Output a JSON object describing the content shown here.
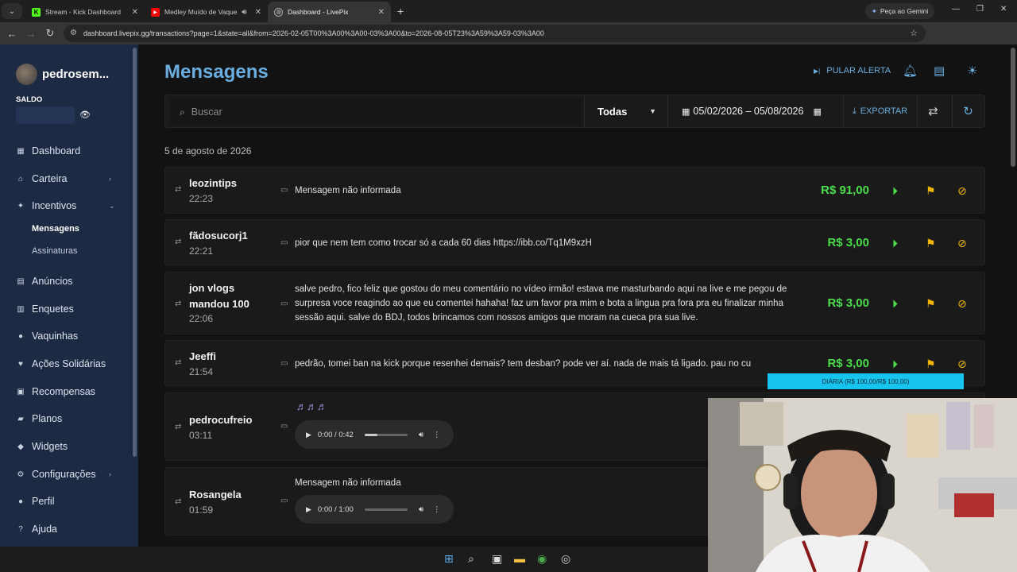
{
  "browser": {
    "tabs": [
      {
        "title": "Stream - Kick Dashboard",
        "icon": "kick-icon"
      },
      {
        "title": "Medley Muído de Vaquejad",
        "icon": "youtube-icon"
      },
      {
        "title": "Dashboard - LivePix",
        "icon": "globe-icon"
      }
    ],
    "gemini_label": "Peça ao Gemini",
    "url": "dashboard.livepix.gg/transactions?page=1&state=all&from=2026-02-05T00%3A00%3A00-03%3A00&to=2026-08-05T23%3A59%3A59-03%3A00"
  },
  "sidebar": {
    "username": "pedrosem...",
    "saldo_label": "SALDO",
    "items": [
      {
        "label": "Dashboard",
        "icon": "dashboard-icon"
      },
      {
        "label": "Carteira",
        "icon": "bank-icon",
        "chevron": true
      },
      {
        "label": "Incentivos",
        "icon": "sparkle-icon",
        "chevron": true
      },
      {
        "label": "Anúncios",
        "icon": "ads-icon"
      },
      {
        "label": "Enquetes",
        "icon": "poll-icon"
      },
      {
        "label": "Vaquinhas",
        "icon": "piggy-icon"
      },
      {
        "label": "Ações Solidárias",
        "icon": "heart-hand-icon"
      },
      {
        "label": "Recompensas",
        "icon": "gift-icon"
      },
      {
        "label": "Planos",
        "icon": "plans-icon"
      },
      {
        "label": "Widgets",
        "icon": "widgets-icon"
      },
      {
        "label": "Configurações",
        "icon": "settings-icon",
        "chevron": true
      },
      {
        "label": "Perfil",
        "icon": "user-icon"
      },
      {
        "label": "Ajuda",
        "icon": "help-icon"
      }
    ],
    "subitems": [
      {
        "label": "Mensagens",
        "active": true
      },
      {
        "label": "Assinaturas",
        "active": false
      }
    ]
  },
  "header": {
    "title": "Mensagens",
    "pular_alerta": "PULAR ALERTA"
  },
  "filters": {
    "search_placeholder": "Buscar",
    "status_select": "Todas",
    "date_range": "05/02/2026 – 05/08/2026",
    "export_label": "EXPORTAR"
  },
  "date_header": "5 de agosto de 2026",
  "messages": [
    {
      "user": "leozintips",
      "time": "22:23",
      "text": "Mensagem não informada",
      "amount": "R$ 91,00"
    },
    {
      "user": "fãdosucorj1",
      "time": "22:21",
      "text": "pior que nem tem como trocar só a cada 60 dias https://ibb.co/Tq1M9xzH",
      "amount": "R$ 3,00"
    },
    {
      "user": "jon vlogs mandou 100",
      "time": "22:06",
      "text": "salve pedro, fico feliz que gostou do meu comentário no vídeo irmão! estava me masturbando aqui na live e me pegou de surpresa voce reagindo ao que eu comentei hahaha! faz um favor pra mim e bota a lingua pra fora pra eu finalizar minha sessão aqui. salve do BDJ, todos brincamos com nossos amigos que moram na cueca pra sua live.",
      "amount": "R$ 3,00"
    },
    {
      "user": "Jeeffi",
      "time": "21:54",
      "text": "pedrão, tomei ban na kick porque resenhei demais? tem desban? pode ver aí. nada de mais tá ligado. pau no cu",
      "amount": "R$ 3,00"
    },
    {
      "user": "pedrocufreio",
      "time": "03:11",
      "notes": "♬♬♬",
      "audio": "0:00 / 0:42",
      "audio_progress": 0.3
    },
    {
      "user": "Rosangela",
      "time": "01:59",
      "text": "Mensagem não informada",
      "audio": "0:00 / 1:00",
      "audio_progress": 0.0
    }
  ],
  "overlay": {
    "goal_bar": "DIÁRIA (R$ 100,00/R$ 100,00)"
  },
  "colors": {
    "accent": "#6aaee0",
    "amount": "#4ade4a",
    "flag": "#f0b400",
    "sidebar": "#1d2a44"
  }
}
